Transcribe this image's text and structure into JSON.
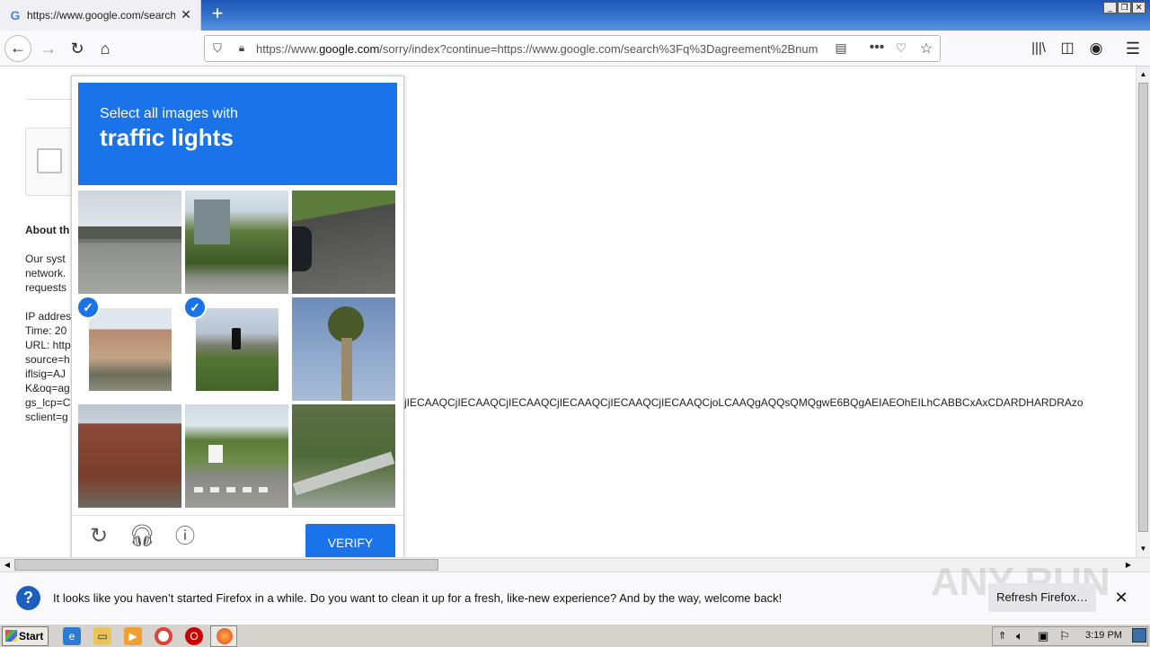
{
  "browser": {
    "tab": {
      "favicon": "google-g-icon",
      "title": "https://www.google.com/search?q"
    },
    "url_prefix": "https://www.",
    "url_domain": "google.com",
    "url_rest": "/sorry/index?continue=https://www.google.com/search%3Fq%3Dagreement%2Bnum"
  },
  "page": {
    "about_heading": "About th",
    "lines": [
      "Our syst",
      "network.",
      "requests"
    ],
    "ip_lines": [
      "IP addres",
      "Time: 20",
      "URL: http",
      "source=h",
      "iflsig=AJ",
      "K&oq=ag",
      "gs_lcp=C",
      "sclient=g"
    ],
    "long_param": "jIECAAQCjIECAAQCjIECAAQCjIECAAQCjIECAAQCjIECAAQCjoLCAAQgAQQsQMQgwE6BQgAEIAEOhEILhCABBCxAxCDARDHARDRAzo"
  },
  "captcha": {
    "prompt_line1": "Select all images with",
    "prompt_line2": "traffic lights",
    "tiles": [
      {
        "label": "overpass highway",
        "selected": false
      },
      {
        "label": "palm trees building",
        "selected": false
      },
      {
        "label": "road car",
        "selected": false
      },
      {
        "label": "storefront traffic light",
        "selected": true
      },
      {
        "label": "traffic light hills",
        "selected": true
      },
      {
        "label": "palm tree sky",
        "selected": false
      },
      {
        "label": "brick building traffic light",
        "selected": false
      },
      {
        "label": "street truck crosswalk",
        "selected": false
      },
      {
        "label": "shrubs guardrail",
        "selected": false
      }
    ],
    "verify_label": "VERIFY"
  },
  "notification": {
    "message": "It looks like you haven’t started Firefox in a while. Do you want to clean it up for a fresh, like-new experience? And by the way, welcome back!",
    "button": "Refresh Firefox…"
  },
  "taskbar": {
    "start": "Start",
    "time": "3:19 PM"
  },
  "watermark": "ANY RUN"
}
